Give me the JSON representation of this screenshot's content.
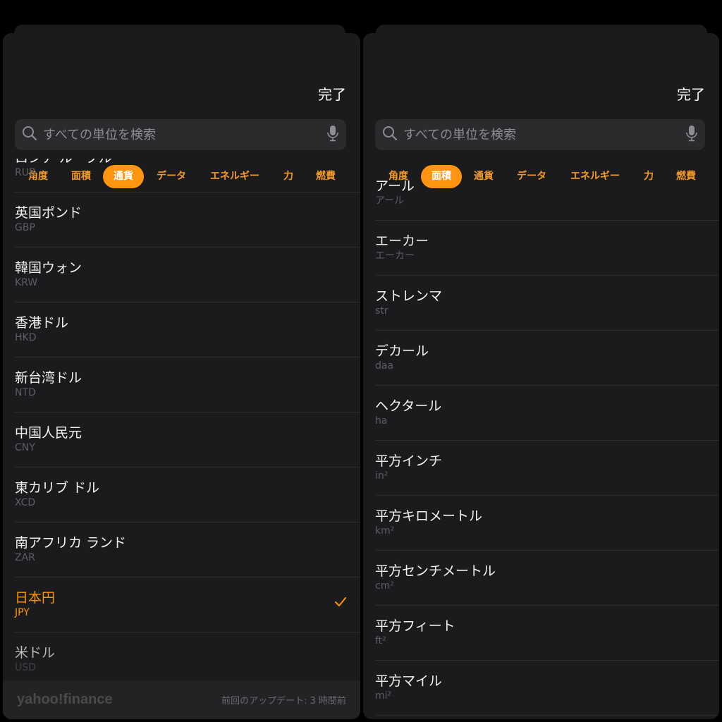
{
  "common": {
    "done_label": "完了",
    "search_placeholder": "すべての単位を検索"
  },
  "tabs": [
    "角度",
    "面積",
    "通貨",
    "データ",
    "エネルギー",
    "力",
    "燃費"
  ],
  "accent_color": "#ff9500",
  "left": {
    "selected_tab": "通貨",
    "rows": [
      {
        "name": "ロシア ルーブル",
        "code": "RUB"
      },
      {
        "name": "英国ポンド",
        "code": "GBP"
      },
      {
        "name": "韓国ウォン",
        "code": "KRW"
      },
      {
        "name": "香港ドル",
        "code": "HKD"
      },
      {
        "name": "新台湾ドル",
        "code": "NTD"
      },
      {
        "name": "中国人民元",
        "code": "CNY"
      },
      {
        "name": "東カリブ ドル",
        "code": "XCD"
      },
      {
        "name": "南アフリカ ランド",
        "code": "ZAR"
      },
      {
        "name": "日本円",
        "code": "JPY",
        "selected": true
      },
      {
        "name": "米ドル",
        "code": "USD"
      }
    ],
    "footer": {
      "logo": "yahoo!finance",
      "updated": "前回のアップデート: 3 時間前"
    }
  },
  "right": {
    "selected_tab": "面積",
    "rows": [
      {
        "name": "アール",
        "code": "アール"
      },
      {
        "name": "エーカー",
        "code": "エーカー"
      },
      {
        "name": "ストレンマ",
        "code": "str"
      },
      {
        "name": "デカール",
        "code": "daa"
      },
      {
        "name": "ヘクタール",
        "code": "ha"
      },
      {
        "name": "平方インチ",
        "code": "in²"
      },
      {
        "name": "平方キロメートル",
        "code": "km²"
      },
      {
        "name": "平方センチメートル",
        "code": "cm²"
      },
      {
        "name": "平方フィート",
        "code": "ft²"
      },
      {
        "name": "平方マイル",
        "code": "mi²"
      }
    ]
  }
}
